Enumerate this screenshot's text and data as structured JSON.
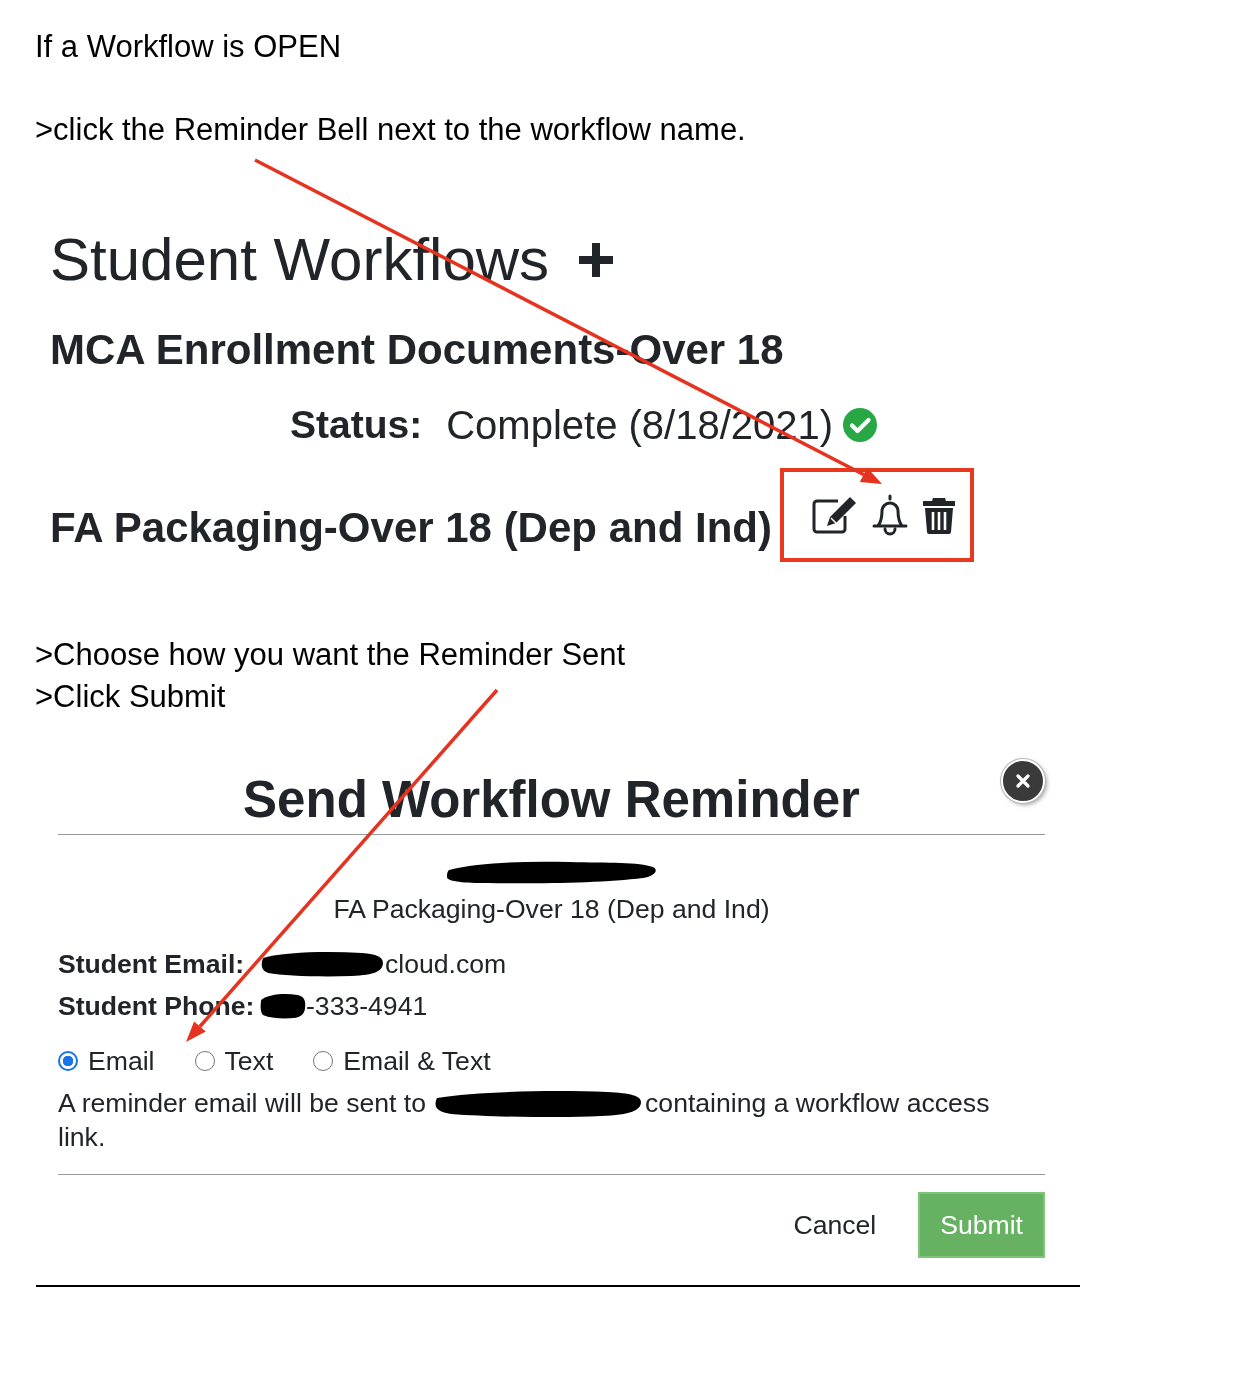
{
  "intro": [
    "If a Workflow is OPEN",
    ">click the Reminder Bell next to the workflow name."
  ],
  "workflows_panel": {
    "title": "Student Workflows",
    "workflows": [
      {
        "name": "MCA Enrollment Documents-Over 18",
        "status": {
          "label": "Status:",
          "value": "Complete (8/18/2021)",
          "complete": true
        }
      },
      {
        "name": "FA Packaging-Over 18 (Dep and Ind)",
        "actions": {
          "highlighted": true
        }
      }
    ]
  },
  "steps": [
    ">Choose how you want the Reminder Sent",
    ">Click Submit"
  ],
  "reminder_dialog": {
    "title": "Send Workflow Reminder",
    "name_redacted": true,
    "workflow": "FA Packaging-Over 18 (Dep and Ind)",
    "contact": [
      {
        "label": "Student Email:",
        "value": "cloud.com",
        "redacted": true
      },
      {
        "label": "Student Phone:",
        "value": "-333-4941",
        "redacted": true
      }
    ],
    "delivery_options": [
      {
        "label": "Email",
        "selected": true
      },
      {
        "label": "Text",
        "selected": false
      },
      {
        "label": "Email & Text",
        "selected": false
      }
    ],
    "message": {
      "before": "A reminder email will be sent to",
      "recipient_redacted": true,
      "after_lines": [
        "containing a workflow access",
        "link."
      ]
    },
    "buttons": [
      {
        "label": "Cancel",
        "kind": "plain"
      },
      {
        "label": "Submit",
        "kind": "primary"
      }
    ]
  }
}
